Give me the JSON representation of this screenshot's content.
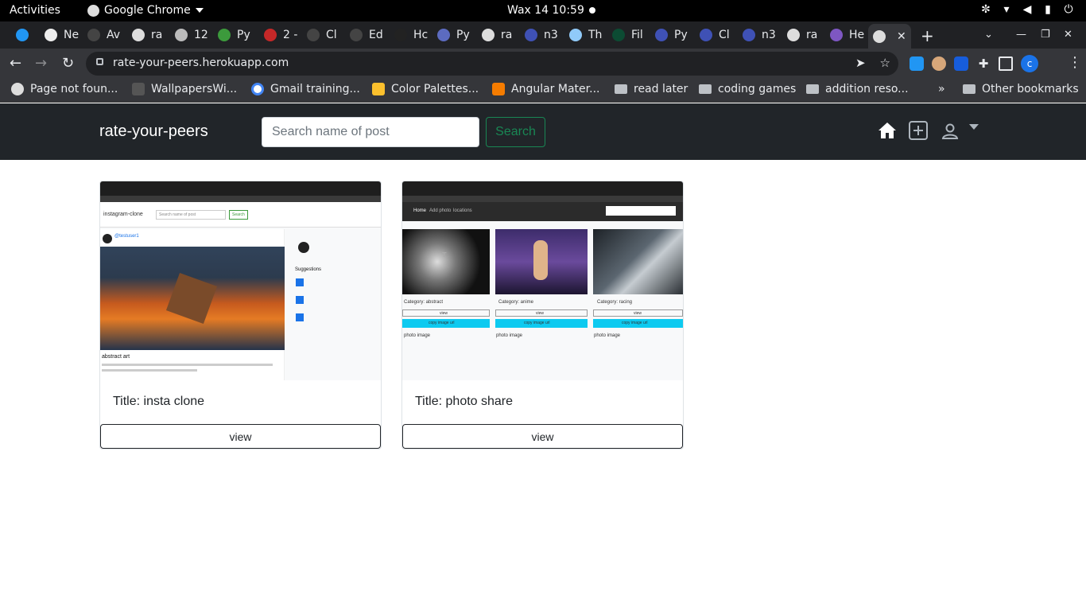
{
  "system": {
    "activities": "Activities",
    "app_name": "Google Chrome",
    "clock": "Wax 14  10:59"
  },
  "tabs": [
    {
      "label": "Ne"
    },
    {
      "label": "Av"
    },
    {
      "label": "ra"
    },
    {
      "label": "12"
    },
    {
      "label": "Py"
    },
    {
      "label": "2 -"
    },
    {
      "label": "Cl"
    },
    {
      "label": "Ed"
    },
    {
      "label": "Hc"
    },
    {
      "label": "Py"
    },
    {
      "label": "ra"
    },
    {
      "label": "n3"
    },
    {
      "label": "Th"
    },
    {
      "label": "Fil"
    },
    {
      "label": "Py"
    },
    {
      "label": "Cl"
    },
    {
      "label": "n3"
    },
    {
      "label": "ra"
    },
    {
      "label": "He"
    }
  ],
  "browser": {
    "url": "rate-your-peers.herokuapp.com",
    "profile_initial": "c"
  },
  "bookmarks": [
    {
      "label": "Page not foun..."
    },
    {
      "label": "WallpapersWi..."
    },
    {
      "label": "Gmail training..."
    },
    {
      "label": "Color Palettes..."
    },
    {
      "label": "Angular Mater..."
    },
    {
      "label": "read later"
    },
    {
      "label": "coding games"
    },
    {
      "label": "addition reso..."
    },
    {
      "label": "Other bookmarks"
    }
  ],
  "site": {
    "brand": "rate-your-peers",
    "search_placeholder": "Search name of post",
    "search_button": "Search"
  },
  "cards": [
    {
      "title": "Title: insta clone",
      "button": "view",
      "preview": {
        "app": "instagram-clone",
        "search": "Search name of post",
        "search_btn": "Search",
        "user": "@testuser1",
        "suggestions": "Suggestions",
        "post_title": "abstract art"
      }
    },
    {
      "title": "Title: photo share",
      "button": "view",
      "preview": {
        "nav_home": "Home",
        "nav_add": "Add photo",
        "nav_loc": "locations",
        "categories": [
          "Category: abstract",
          "Category: anime",
          "Category: racing"
        ],
        "view": "view",
        "copy": "copy image url",
        "alt": "photo image"
      }
    }
  ]
}
